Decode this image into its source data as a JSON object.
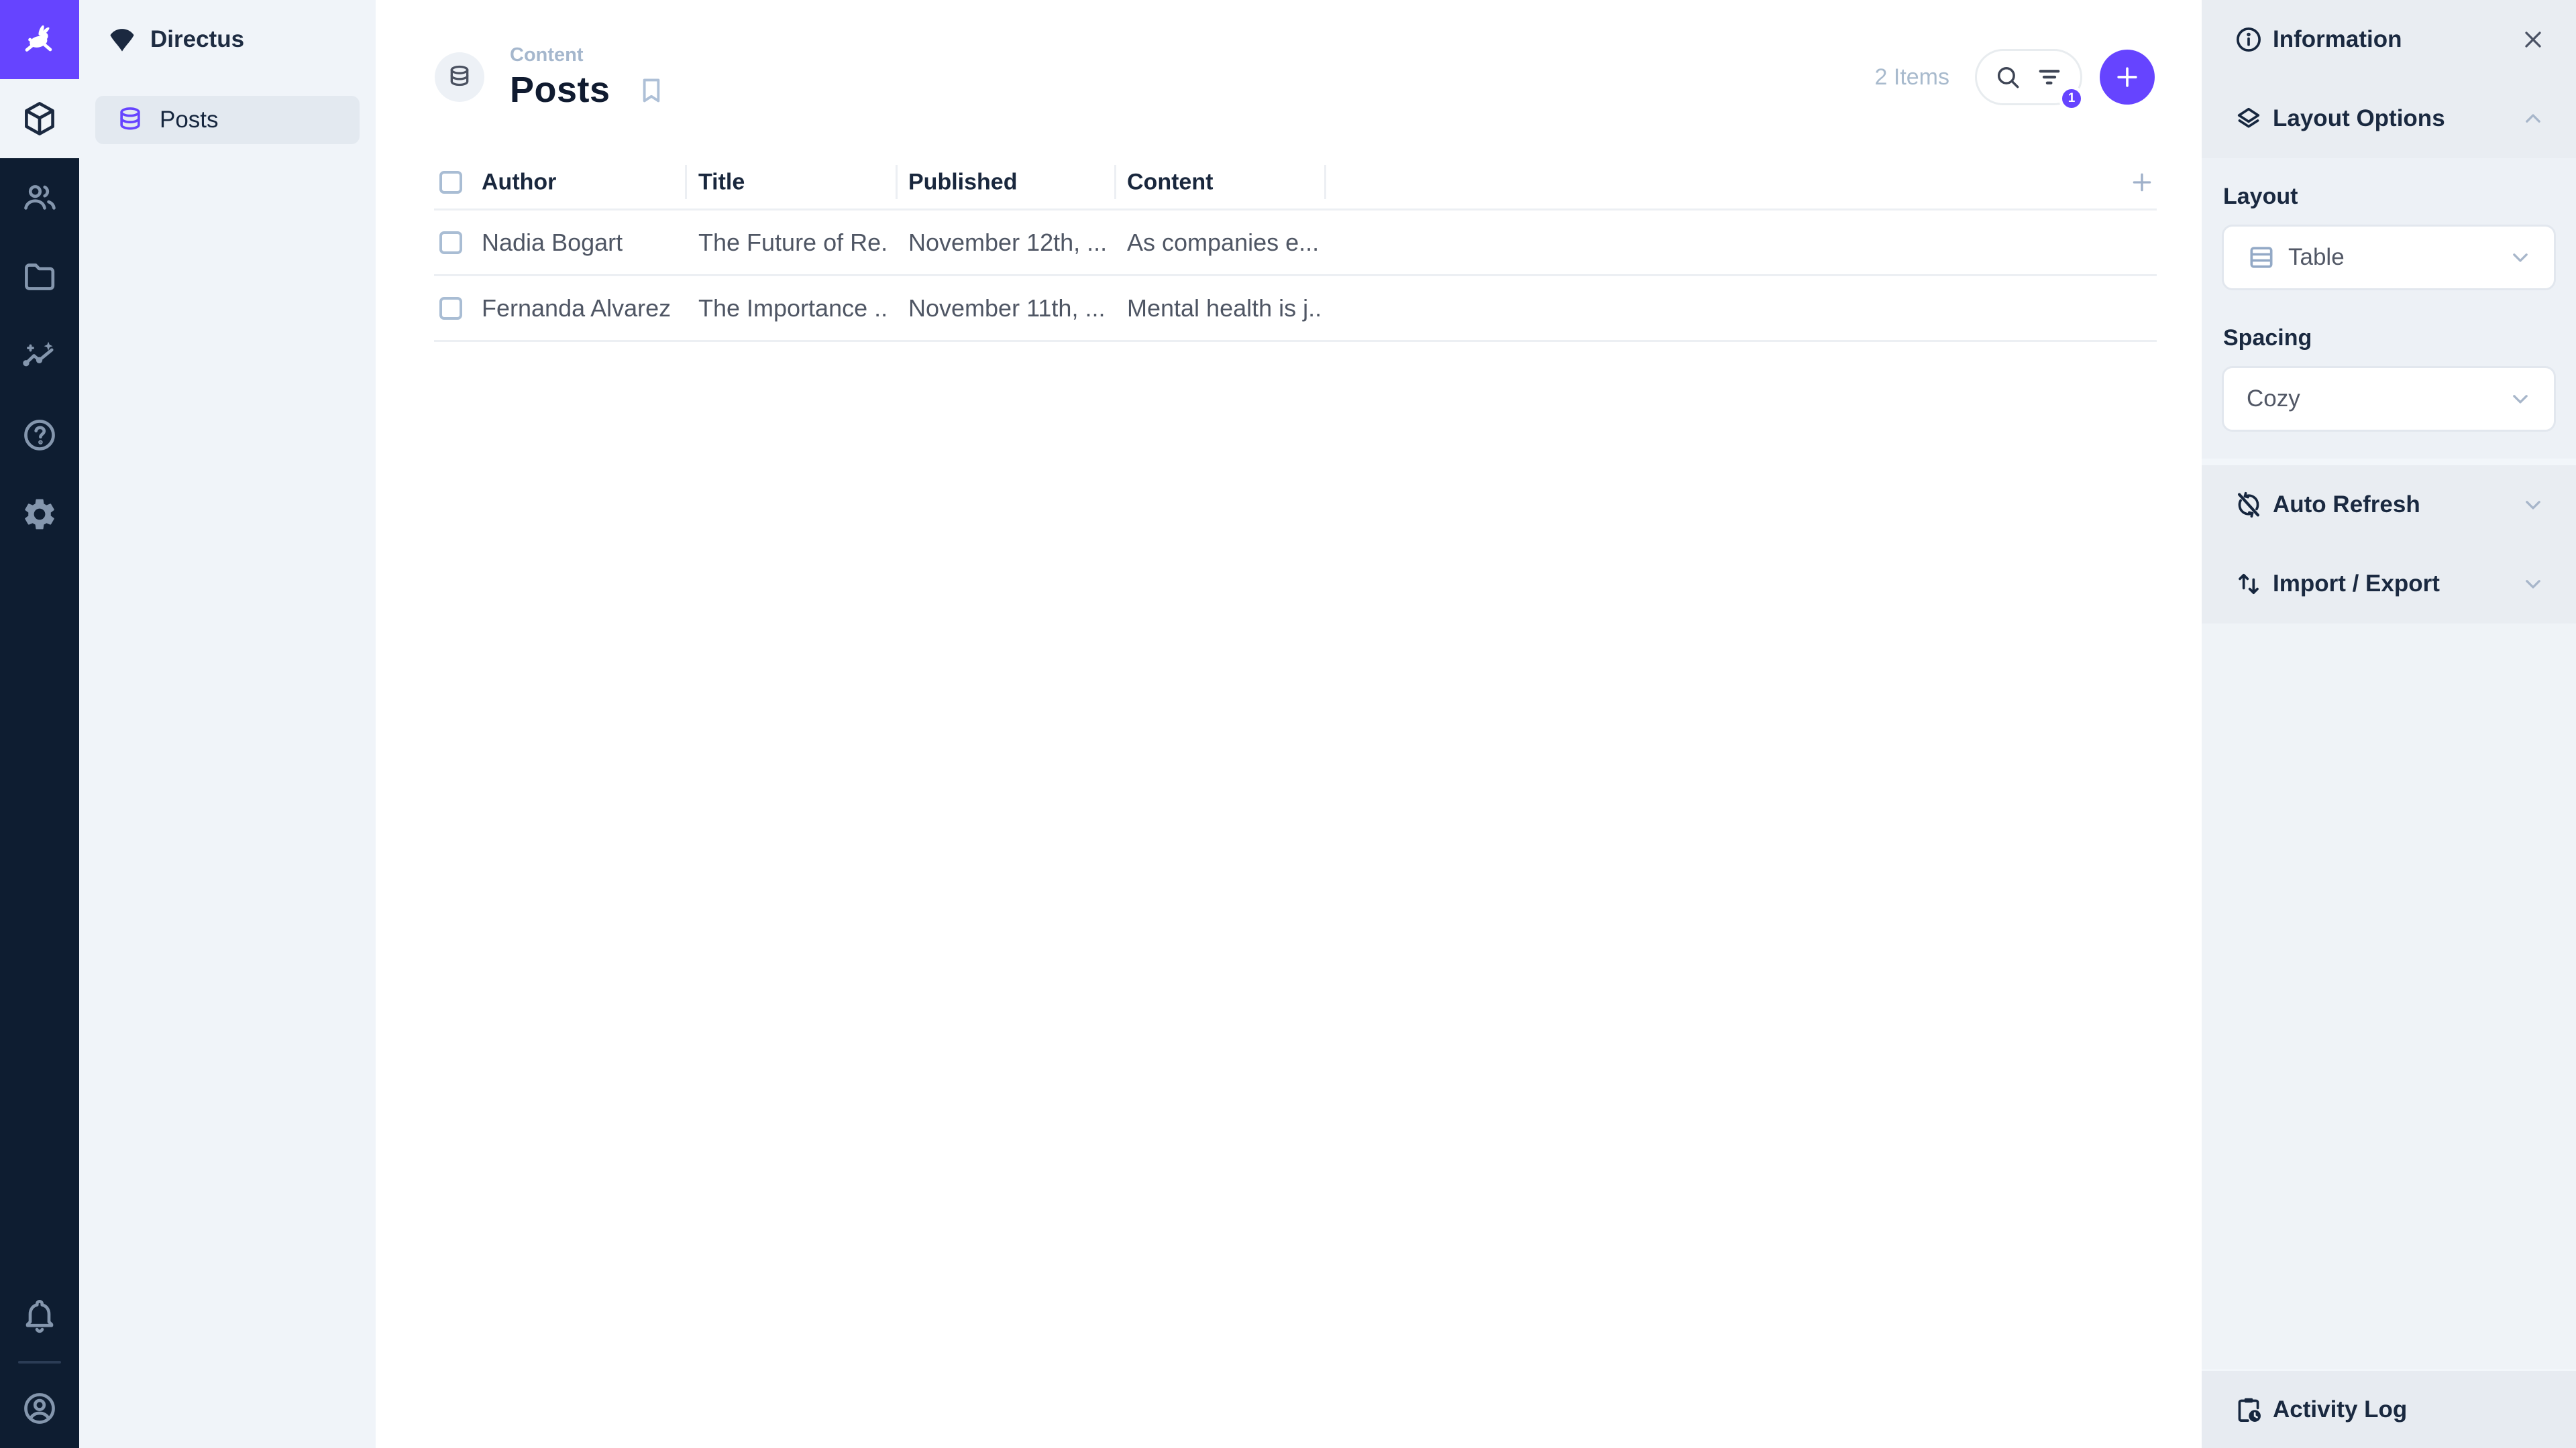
{
  "app": {
    "project_name": "Directus"
  },
  "module_bar": {
    "modules": [
      {
        "name": "content",
        "icon": "cube-icon",
        "active": true
      },
      {
        "name": "user-directory",
        "icon": "people-icon",
        "active": false
      },
      {
        "name": "file-library",
        "icon": "folder-icon",
        "active": false
      },
      {
        "name": "insights",
        "icon": "insights-icon",
        "active": false
      },
      {
        "name": "documentation",
        "icon": "help-icon",
        "active": false
      },
      {
        "name": "settings",
        "icon": "gear-icon",
        "active": false
      }
    ],
    "bottom": [
      {
        "name": "notifications",
        "icon": "bell-icon"
      },
      {
        "name": "account",
        "icon": "user-circle-icon"
      }
    ]
  },
  "nav": {
    "header_label": "Directus",
    "items": [
      {
        "label": "Posts",
        "icon": "database-icon",
        "active": true
      }
    ]
  },
  "page_header": {
    "breadcrumb": "Content",
    "title": "Posts",
    "items_count": "2 Items",
    "filter_badge": "1"
  },
  "table": {
    "columns": [
      "Author",
      "Title",
      "Published",
      "Content"
    ],
    "rows": [
      {
        "author": "Nadia Bogart",
        "title": "The Future of Re...",
        "published": "November 12th, ...",
        "content": "As companies e..."
      },
      {
        "author": "Fernanda Alvarez",
        "title": "The Importance ...",
        "published": "November 11th, ...",
        "content": "Mental health is j..."
      }
    ]
  },
  "sidebar": {
    "information_label": "Information",
    "layout_options_label": "Layout Options",
    "fields": {
      "layout_label": "Layout",
      "layout_value": "Table",
      "spacing_label": "Spacing",
      "spacing_value": "Cozy"
    },
    "auto_refresh_label": "Auto Refresh",
    "import_export_label": "Import / Export",
    "activity_log_label": "Activity Log"
  },
  "colors": {
    "accent_purple": "#6644ff",
    "module_bar_bg": "#0e1d31",
    "nav_bg": "#f0f4f9",
    "sidebar_bg": "#e9edf2",
    "text_dark": "#1a2940",
    "text_body": "#4f5664",
    "text_subdued": "#a8bacd",
    "border_subtle": "#eceff3"
  }
}
